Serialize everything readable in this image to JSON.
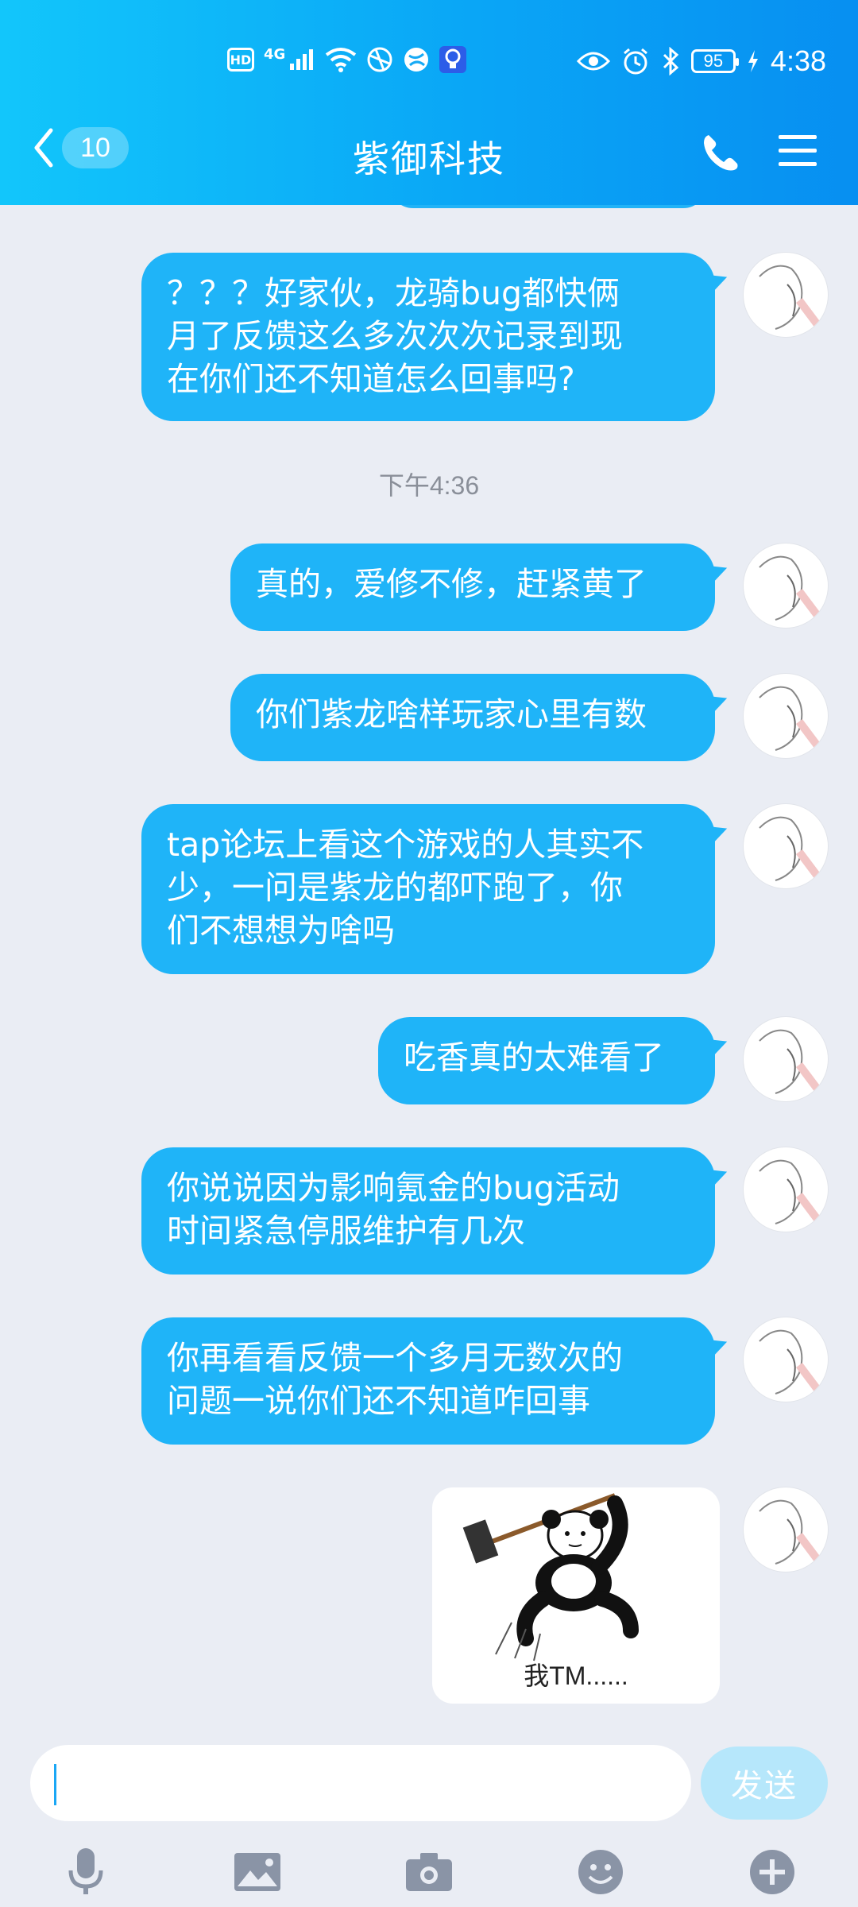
{
  "status_bar": {
    "hd": "HD",
    "network": "4G",
    "battery": "95",
    "time": "4:38"
  },
  "header": {
    "unread_count": "10",
    "title": "紫御科技"
  },
  "timestamp": "下午4:36",
  "messages": [
    {
      "text": "？？？好家伙，龙骑bug都快俩\n月了反馈这么多次次次记录到现\n在你们还不知道怎么回事吗?"
    },
    {
      "text": "真的，爱修不修，赶紧黄了"
    },
    {
      "text": "你们紫龙啥样玩家心里有数"
    },
    {
      "text": "tap论坛上看这个游戏的人其实不\n少，一问是紫龙的都吓跑了，你\n们不想想为啥吗"
    },
    {
      "text": "吃香真的太难看了"
    },
    {
      "text": "你说说因为影响氪金的bug活动\n时间紧急停服维护有几次"
    },
    {
      "text": "你再看看反馈一个多月无数次的\n问题一说你们还不知道咋回事"
    }
  ],
  "sticker": {
    "caption": "我TM......"
  },
  "input": {
    "value": "",
    "send_label": "发送"
  },
  "toolbar_icons": [
    "microphone-icon",
    "image-icon",
    "camera-icon",
    "emoji-icon",
    "plus-icon"
  ],
  "colors": {
    "header_start": "#12c6fb",
    "header_end": "#078ff1",
    "bubble": "#1fb4f8",
    "background": "#eaedf4",
    "send_disabled": "#b6e7fb"
  }
}
